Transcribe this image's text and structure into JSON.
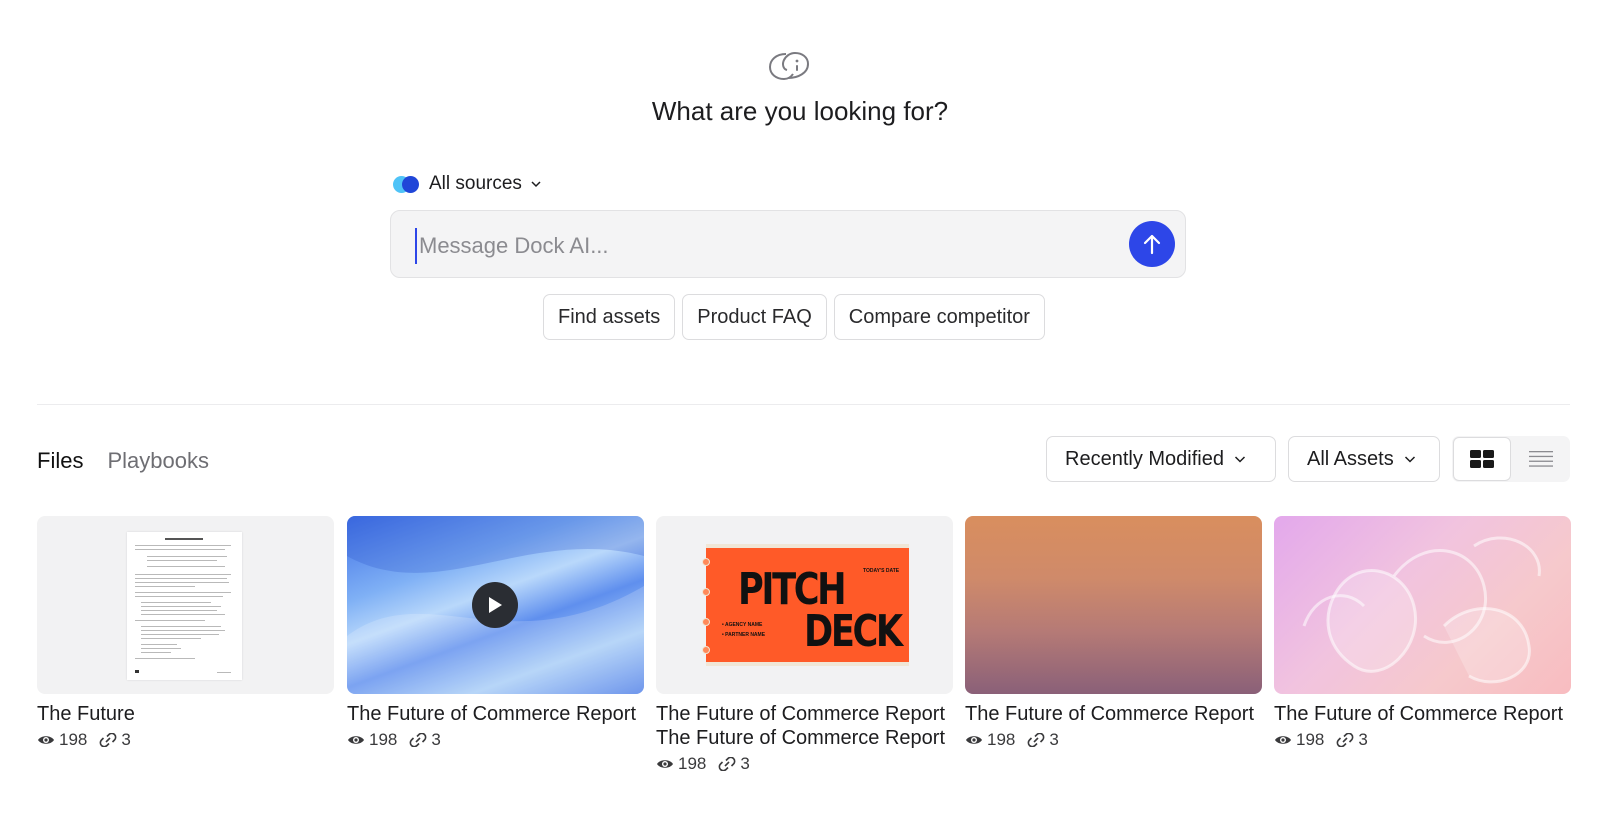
{
  "headline": "What are you looking for?",
  "sources": {
    "label": "All sources"
  },
  "message": {
    "placeholder": "Message Dock AI...",
    "value": ""
  },
  "suggestions": [
    "Find assets",
    "Product FAQ",
    "Compare competitor"
  ],
  "tabs": [
    {
      "label": "Files",
      "active": true
    },
    {
      "label": "Playbooks",
      "active": false
    }
  ],
  "filters": {
    "sort": "Recently Modified",
    "type": "All Assets"
  },
  "view_modes": [
    "grid-view-icon",
    "list-view-icon"
  ],
  "accent_color": "#2d46e8",
  "cards": [
    {
      "title": "The Future",
      "views": "198",
      "links": "3",
      "thumb": "document-thumbnail"
    },
    {
      "title": "The Future of Commerce Report",
      "views": "198",
      "links": "3",
      "thumb": "video-thumbnail"
    },
    {
      "title": "The Future of Commerce Report The Future of Commerce Report",
      "views": "198",
      "links": "3",
      "thumb": "pitch-deck-thumbnail",
      "thumb_text": {
        "word1": "PITCH",
        "word2": "DECK",
        "date": "TODAY'S DATE",
        "agency": "• AGENCY NAME",
        "partner": "• PARTNER NAME"
      }
    },
    {
      "title": "The Future of Commerce Report",
      "views": "198",
      "links": "3",
      "thumb": "gradient-thumbnail"
    },
    {
      "title": "The Future of Commerce Report",
      "views": "198",
      "links": "3",
      "thumb": "abstract-thumbnail"
    }
  ]
}
